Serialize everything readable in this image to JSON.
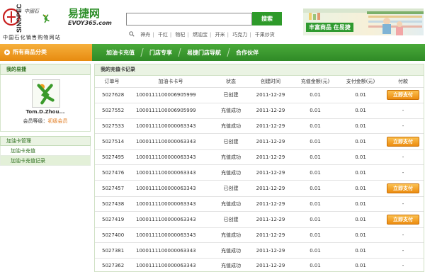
{
  "header": {
    "sinopec_vertical": "SINOPEC",
    "sinopec_caption": "中国石化销售购物网站",
    "site_name": "易捷网",
    "site_domain": "EVOY365.com",
    "search_button": "搜索",
    "search_placeholder": "",
    "hot_keywords": [
      "神舟",
      "千红",
      "物杞",
      "燃油宝",
      "开米",
      "巧克力",
      "干果炒货"
    ],
    "banner_text": "丰富商品  在易捷"
  },
  "nav": {
    "category_label": "所有商品分类",
    "items": [
      "加油卡充值",
      "门店专享",
      "易捷门店导航",
      "合作伙伴"
    ]
  },
  "sidebar": {
    "section_title": "我的易捷",
    "username": "Tom.D.Zhou...",
    "level_prefix": "会员等级：",
    "level_value": "初级会员",
    "menu_head": "加油卡管理",
    "menu_items": [
      "加油卡充值",
      "加油卡充值记录"
    ]
  },
  "main": {
    "title": "我的充值卡记录",
    "columns": [
      "订单号",
      "加油卡卡号",
      "状态",
      "创建时间",
      "充值金额(元)",
      "支付金额(元)",
      "付款"
    ],
    "pay_label": "立即支付",
    "dash": "-",
    "rows": [
      {
        "order": "5027628",
        "card": "1000111100006905999",
        "status": "已创建",
        "time": "2011-12-29",
        "recharge": "0.01",
        "paid": "0.01",
        "payable": true
      },
      {
        "order": "5027552",
        "card": "1000111100006905999",
        "status": "充值成功",
        "time": "2011-12-29",
        "recharge": "0.01",
        "paid": "0.01",
        "payable": false
      },
      {
        "order": "5027533",
        "card": "1000111100000063343",
        "status": "充值成功",
        "time": "2011-12-29",
        "recharge": "0.01",
        "paid": "0.01",
        "payable": false
      },
      {
        "order": "5027514",
        "card": "1000111100000063343",
        "status": "已创建",
        "time": "2011-12-29",
        "recharge": "0.01",
        "paid": "0.01",
        "payable": true
      },
      {
        "order": "5027495",
        "card": "1000111100000063343",
        "status": "充值成功",
        "time": "2011-12-29",
        "recharge": "0.01",
        "paid": "0.01",
        "payable": false
      },
      {
        "order": "5027476",
        "card": "1000111100000063343",
        "status": "充值成功",
        "time": "2011-12-29",
        "recharge": "0.01",
        "paid": "0.01",
        "payable": false
      },
      {
        "order": "5027457",
        "card": "1000111100000063343",
        "status": "已创建",
        "time": "2011-12-29",
        "recharge": "0.01",
        "paid": "0.01",
        "payable": true
      },
      {
        "order": "5027438",
        "card": "1000111100000063343",
        "status": "充值成功",
        "time": "2011-12-29",
        "recharge": "0.01",
        "paid": "0.01",
        "payable": false
      },
      {
        "order": "5027419",
        "card": "1000111100000063343",
        "status": "已创建",
        "time": "2011-12-29",
        "recharge": "0.01",
        "paid": "0.01",
        "payable": true
      },
      {
        "order": "5027400",
        "card": "1000111100000063343",
        "status": "充值成功",
        "time": "2011-12-29",
        "recharge": "0.01",
        "paid": "0.01",
        "payable": false
      },
      {
        "order": "5027381",
        "card": "1000111100000063343",
        "status": "充值成功",
        "time": "2011-12-29",
        "recharge": "0.01",
        "paid": "0.01",
        "payable": false
      },
      {
        "order": "5027362",
        "card": "1000111100000063343",
        "status": "充值成功",
        "time": "2011-12-29",
        "recharge": "0.01",
        "paid": "0.01",
        "payable": false
      }
    ]
  },
  "colors": {
    "brand_green": "#2e9a2a",
    "nav_green": "#3c9a30",
    "accent_orange": "#ec8c10"
  }
}
